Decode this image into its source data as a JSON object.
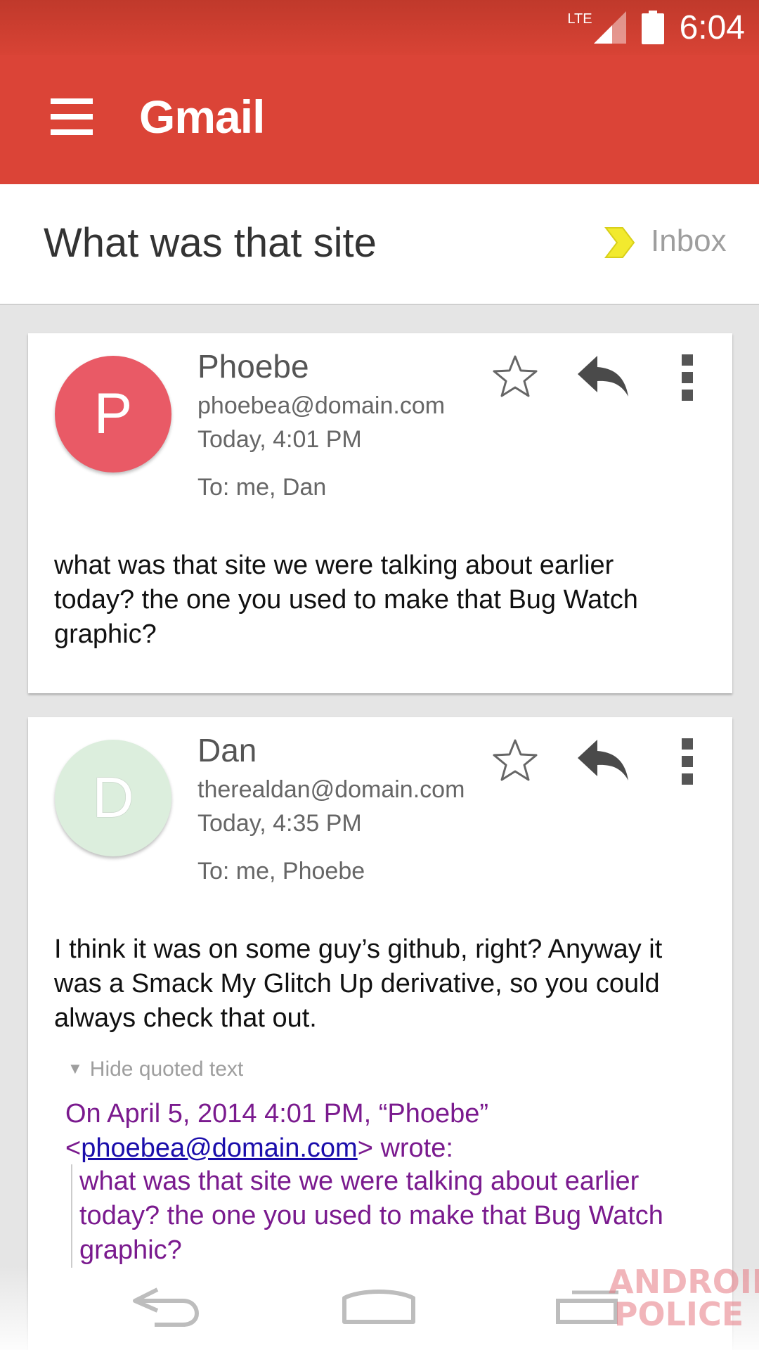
{
  "status_bar": {
    "network": "LTE",
    "time": "6:04"
  },
  "app": {
    "title": "Gmail"
  },
  "thread": {
    "subject": "What was that site",
    "label": "Inbox",
    "label_color": "#f2ea2e"
  },
  "messages": [
    {
      "avatar_letter": "P",
      "avatar_color": "#e95a66",
      "sender": "Phoebe",
      "email": "phoebea@domain.com",
      "date": "Today, 4:01 PM",
      "to": "To: me, Dan",
      "body": "what was that site we were talking about earlier today? the one you used to make that Bug Watch graphic?"
    },
    {
      "avatar_letter": "D",
      "avatar_color": "#dceedd",
      "sender": "Dan",
      "email": "therealdan@domain.com",
      "date": "Today, 4:35 PM",
      "to": "To: me, Phoebe",
      "body": "I think it was on some guy’s github, right? Anyway it was a Smack My Glitch Up derivative, so you could always check that out.",
      "hide_quoted": "Hide quoted text",
      "quote_intro": "On April 5, 2014  4:01 PM, “Phoebe”",
      "quote_lt": "<",
      "quote_email": "phoebea@domain.com",
      "quote_wrote": "> wrote:",
      "quote_text": "what was that site we were talking about earlier today? the one you used to make that Bug Watch graphic?"
    }
  ],
  "icons": {
    "menu": "menu-icon",
    "star": "star-outline-icon",
    "reply": "reply-icon",
    "more": "more-vert-icon",
    "back": "back-icon",
    "home": "home-icon",
    "recents": "recents-icon"
  },
  "watermark": {
    "line1": "ANDROID",
    "line2": "POLICE"
  },
  "colors": {
    "app_bar": "#db4437",
    "quote_text": "#7a1a8e",
    "link": "#1a0dab"
  }
}
